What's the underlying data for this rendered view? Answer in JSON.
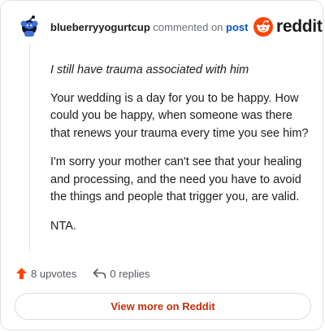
{
  "header": {
    "username": "blueberryyogurtcup",
    "action_text": "commented on",
    "post_link": "post",
    "brand": "reddit"
  },
  "comment": {
    "quote": "I still have trauma associated with him",
    "paragraphs": [
      "Your wedding is a day for you to be happy. How could you be happy, when someone was there that renews your trauma every time you see him?",
      "I'm sorry your mother can't see that your healing and processing, and the need you have to avoid the things and people that trigger you, are valid.",
      "NTA."
    ]
  },
  "actions": {
    "upvotes": "8 upvotes",
    "replies": "0 replies"
  },
  "view_more_label": "View more on Reddit",
  "colors": {
    "accent": "#ff4500",
    "link": "#0a54b8",
    "view_more_text": "#c2300a"
  },
  "icons": {
    "avatar": "snoo-avatar-icon",
    "brand": "reddit-logo-icon",
    "upvote": "upvote-arrow-icon",
    "reply": "reply-arrow-icon"
  }
}
